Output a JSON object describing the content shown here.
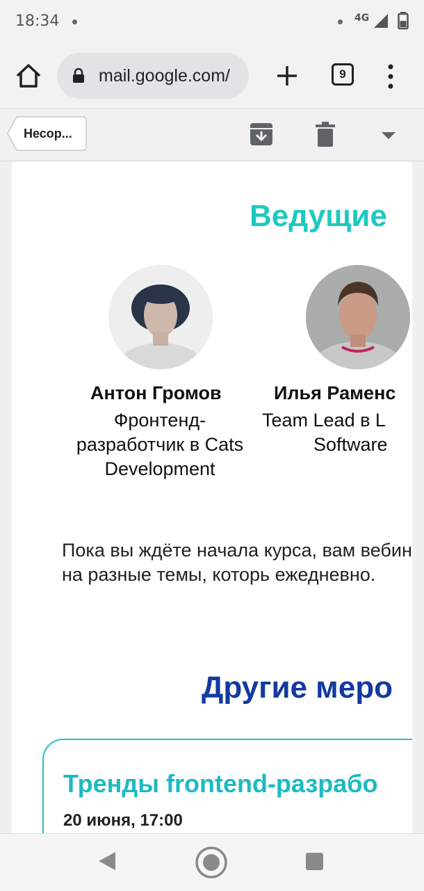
{
  "status_bar": {
    "time": "18:34",
    "network": "4G"
  },
  "browser": {
    "url": "mail.google.com/",
    "tab_count": "9"
  },
  "gmail_toolbar": {
    "back_label": "Несор..."
  },
  "email": {
    "hosts_title": "Ведущие",
    "hosts": [
      {
        "name": "Антон Громов",
        "role": "Фронтенд-разработчик в Cats Development"
      },
      {
        "name": "Илья Раменс",
        "role_lines": [
          "Team Lead в L",
          "Software"
        ]
      }
    ],
    "promo_text": "Пока вы ждёте начала курса, вам вебинары на разные темы, которь ежедневно.",
    "other_title": "Другие меро",
    "event": {
      "title": "Тренды frontend-разрабо",
      "date": "20 июня, 17:00"
    }
  },
  "colors": {
    "accent_teal": "#1dc9bf",
    "title_blue": "#143a9e"
  }
}
